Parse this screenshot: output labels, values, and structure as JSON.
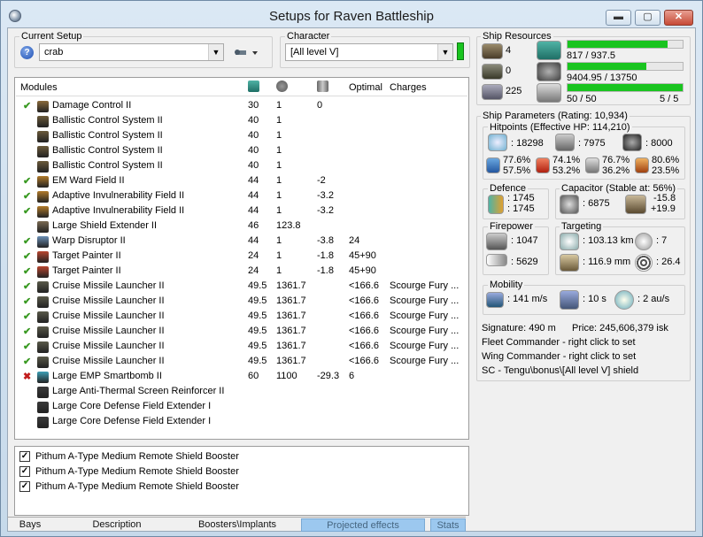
{
  "window": {
    "title": "Setups for Raven Battleship",
    "minimize": "▬",
    "maximize": "▢",
    "close": "✕"
  },
  "setup": {
    "current_label": "Current Setup",
    "current_value": "crab",
    "character_label": "Character",
    "character_value": "[All level V]",
    "help_glyph": "?"
  },
  "modules": {
    "headers": {
      "name": "Modules",
      "optimal": "Optimal",
      "charges": "Charges"
    },
    "rows": [
      {
        "state": "on",
        "name": "Damage Control II",
        "cpu": "30",
        "pg": "1",
        "cap": "0",
        "optimal": "",
        "charges": "",
        "icon": "damage-control-icon",
        "color": "#8a6a3b"
      },
      {
        "state": "",
        "name": "Ballistic Control System II",
        "cpu": "40",
        "pg": "1",
        "cap": "",
        "optimal": "",
        "charges": "",
        "icon": "ballistic-control-icon",
        "color": "#6b5a3a"
      },
      {
        "state": "",
        "name": "Ballistic Control System II",
        "cpu": "40",
        "pg": "1",
        "cap": "",
        "optimal": "",
        "charges": "",
        "icon": "ballistic-control-icon",
        "color": "#6b5a3a"
      },
      {
        "state": "",
        "name": "Ballistic Control System II",
        "cpu": "40",
        "pg": "1",
        "cap": "",
        "optimal": "",
        "charges": "",
        "icon": "ballistic-control-icon",
        "color": "#6b5a3a"
      },
      {
        "state": "",
        "name": "Ballistic Control System II",
        "cpu": "40",
        "pg": "1",
        "cap": "",
        "optimal": "",
        "charges": "",
        "icon": "ballistic-control-icon",
        "color": "#6b5a3a"
      },
      {
        "state": "on",
        "name": "EM Ward Field II",
        "cpu": "44",
        "pg": "1",
        "cap": "-2",
        "optimal": "",
        "charges": "",
        "icon": "em-ward-icon",
        "color": "#b07a2a"
      },
      {
        "state": "on",
        "name": "Adaptive Invulnerability Field II",
        "cpu": "44",
        "pg": "1",
        "cap": "-3.2",
        "optimal": "",
        "charges": "",
        "icon": "invulnerability-field-icon",
        "color": "#b07a2a"
      },
      {
        "state": "on",
        "name": "Adaptive Invulnerability Field II",
        "cpu": "44",
        "pg": "1",
        "cap": "-3.2",
        "optimal": "",
        "charges": "",
        "icon": "invulnerability-field-icon",
        "color": "#b07a2a"
      },
      {
        "state": "",
        "name": "Large Shield Extender II",
        "cpu": "46",
        "pg": "123.8",
        "cap": "",
        "optimal": "",
        "charges": "",
        "icon": "shield-extender-icon",
        "color": "#7a6a52"
      },
      {
        "state": "on",
        "name": "Warp Disruptor II",
        "cpu": "44",
        "pg": "1",
        "cap": "-3.8",
        "optimal": "24",
        "charges": "",
        "icon": "warp-disruptor-icon",
        "color": "#6b8fb5"
      },
      {
        "state": "on",
        "name": "Target Painter II",
        "cpu": "24",
        "pg": "1",
        "cap": "-1.8",
        "optimal": "45+90",
        "charges": "",
        "icon": "target-painter-icon",
        "color": "#b8452e"
      },
      {
        "state": "on",
        "name": "Target Painter II",
        "cpu": "24",
        "pg": "1",
        "cap": "-1.8",
        "optimal": "45+90",
        "charges": "",
        "icon": "target-painter-icon",
        "color": "#b8452e"
      },
      {
        "state": "on",
        "name": "Cruise Missile Launcher II",
        "cpu": "49.5",
        "pg": "1361.7",
        "cap": "",
        "optimal": "<166.6",
        "charges": "Scourge Fury ...",
        "icon": "missile-launcher-icon",
        "color": "#5a5a4a"
      },
      {
        "state": "on",
        "name": "Cruise Missile Launcher II",
        "cpu": "49.5",
        "pg": "1361.7",
        "cap": "",
        "optimal": "<166.6",
        "charges": "Scourge Fury ...",
        "icon": "missile-launcher-icon",
        "color": "#5a5a4a"
      },
      {
        "state": "on",
        "name": "Cruise Missile Launcher II",
        "cpu": "49.5",
        "pg": "1361.7",
        "cap": "",
        "optimal": "<166.6",
        "charges": "Scourge Fury ...",
        "icon": "missile-launcher-icon",
        "color": "#5a5a4a"
      },
      {
        "state": "on",
        "name": "Cruise Missile Launcher II",
        "cpu": "49.5",
        "pg": "1361.7",
        "cap": "",
        "optimal": "<166.6",
        "charges": "Scourge Fury ...",
        "icon": "missile-launcher-icon",
        "color": "#5a5a4a"
      },
      {
        "state": "on",
        "name": "Cruise Missile Launcher II",
        "cpu": "49.5",
        "pg": "1361.7",
        "cap": "",
        "optimal": "<166.6",
        "charges": "Scourge Fury ...",
        "icon": "missile-launcher-icon",
        "color": "#5a5a4a"
      },
      {
        "state": "on",
        "name": "Cruise Missile Launcher II",
        "cpu": "49.5",
        "pg": "1361.7",
        "cap": "",
        "optimal": "<166.6",
        "charges": "Scourge Fury ...",
        "icon": "missile-launcher-icon",
        "color": "#5a5a4a"
      },
      {
        "state": "off",
        "name": "Large EMP Smartbomb II",
        "cpu": "60",
        "pg": "1100",
        "cap": "-29.3",
        "optimal": "6",
        "charges": "",
        "icon": "smartbomb-icon",
        "color": "#3c9fb5"
      },
      {
        "state": "",
        "name": "Large Anti-Thermal Screen Reinforcer II",
        "cpu": "",
        "pg": "",
        "cap": "",
        "optimal": "",
        "charges": "",
        "icon": "rig-icon",
        "color": "#3a3a3a"
      },
      {
        "state": "",
        "name": "Large Core Defense Field Extender I",
        "cpu": "",
        "pg": "",
        "cap": "",
        "optimal": "",
        "charges": "",
        "icon": "rig-icon",
        "color": "#3a3a3a"
      },
      {
        "state": "",
        "name": "Large Core Defense Field Extender I",
        "cpu": "",
        "pg": "",
        "cap": "",
        "optimal": "",
        "charges": "",
        "icon": "rig-icon",
        "color": "#3a3a3a"
      }
    ]
  },
  "projected": {
    "items": [
      {
        "label": "Pithum A-Type Medium Remote Shield Booster",
        "checked": true
      },
      {
        "label": "Pithum A-Type Medium Remote Shield Booster",
        "checked": true
      },
      {
        "label": "Pithum A-Type Medium Remote Shield Booster",
        "checked": true
      }
    ]
  },
  "tabs": [
    "Bays",
    "Description",
    "Boosters\\Implants",
    "Projected effects",
    "Stats"
  ],
  "tabs_selected": "Projected effects",
  "resources": {
    "title": "Ship Resources",
    "launchers": "4",
    "turrets": "0",
    "drones": "225",
    "cpu_text": "817 / 937.5",
    "cpu_fraction": 0.871,
    "pg_text": "9404.95 / 13750",
    "pg_fraction": 0.684,
    "calib_text": "50 / 50",
    "calib_fraction": 1.0,
    "slots_text": "5 / 5"
  },
  "params": {
    "title": "Ship Parameters (Rating: 10,934)",
    "hp_title": "Hitpoints (Effective HP: 114,210)",
    "shield_hp": ": 18298",
    "armor_hp": ": 7975",
    "structure_hp": ": 8000",
    "res": [
      [
        "77.6%",
        "57.5%"
      ],
      [
        "74.1%",
        "53.2%"
      ],
      [
        "76.7%",
        "36.2%"
      ],
      [
        "80.6%",
        "23.5%"
      ]
    ],
    "defence_title": "Defence",
    "defence_vals": [
      ": 1745",
      ": 1745"
    ],
    "capacitor_title": "Capacitor (Stable at: 56%)",
    "capacitor_amount": ": 6875",
    "capacitor_delta": [
      "-15.8",
      "+19.9"
    ],
    "firepower_title": "Firepower",
    "firepower_vals": [
      ": 1047",
      ": 5629"
    ],
    "targeting_title": "Targeting",
    "target_range": ": 103.13 km",
    "max_targets": ": 7",
    "scan_res": ": 116.9 mm",
    "sensor_strength": ": 26.4",
    "mobility_title": "Mobility",
    "speed": ": 141 m/s",
    "align": ": 10 s",
    "warp": ": 2 au/s",
    "signature": "Signature: 490 m",
    "price": "Price: 245,606,379 isk",
    "fleet_cmd": "Fleet Commander - right click to set",
    "wing_cmd": "Wing Commander - right click to set",
    "sc": "SC - Tengu\\bonus\\[All level V] shield"
  },
  "colors": {
    "accent_green": "#19c41f",
    "tab_selected": "#9cc8ef",
    "close_red": "#c74a35"
  }
}
